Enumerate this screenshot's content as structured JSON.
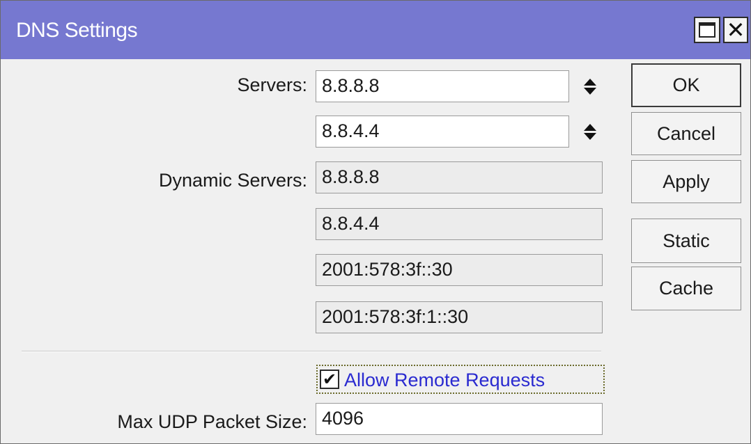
{
  "window": {
    "title": "DNS Settings",
    "maximize_glyph": "",
    "close_glyph": "✕"
  },
  "servers": {
    "label": "Servers:",
    "values": [
      "8.8.8.8",
      "8.8.4.4"
    ]
  },
  "dynamic_servers": {
    "label": "Dynamic Servers:",
    "values": [
      "8.8.8.8",
      "8.8.4.4",
      "2001:578:3f::30",
      "2001:578:3f:1::30"
    ]
  },
  "allow_remote": {
    "label": "Allow Remote Requests",
    "checked": true,
    "check_glyph": "✔"
  },
  "max_udp": {
    "label": "Max UDP Packet Size:",
    "value": "4096"
  },
  "buttons": {
    "ok": "OK",
    "cancel": "Cancel",
    "apply": "Apply",
    "static": "Static",
    "cache": "Cache"
  },
  "colors": {
    "titlebar": "#7678d0",
    "link_text": "#2a2ad0"
  },
  "icons": {
    "maximize": "maximize-icon",
    "close": "close-icon",
    "spinner": "up-down-spinner-icon",
    "check": "checkmark-icon"
  }
}
